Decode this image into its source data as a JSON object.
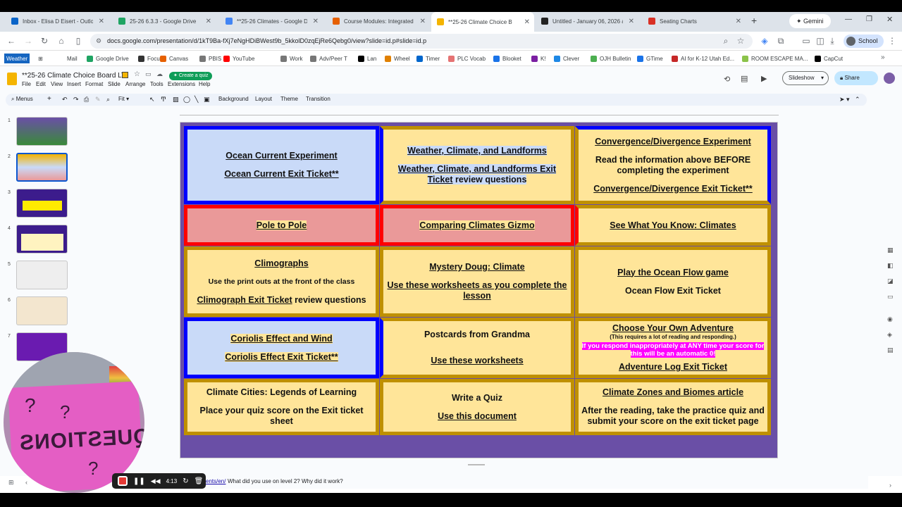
{
  "browser": {
    "tabs": [
      {
        "label": "Inbox - Elisa D Eisert - Outlo",
        "icon": "outlook-icon",
        "color": "#0a64c8"
      },
      {
        "label": "25-26 6.3.3 - Google Drive",
        "icon": "drive-icon",
        "color": "#1fa463"
      },
      {
        "label": "**25-26 Climates - Google D",
        "icon": "docs-icon",
        "color": "#4285f4"
      },
      {
        "label": "Course Modules: Integrated",
        "icon": "canvas-icon",
        "color": "#e66000"
      },
      {
        "label": "**25-26 Climate Choice B",
        "icon": "slides-icon",
        "color": "#f4b400"
      },
      {
        "label": "Untitled - January 06, 2026 a",
        "icon": "notion-icon",
        "color": "#222"
      },
      {
        "label": "Seating Charts",
        "icon": "seating-icon",
        "color": "#d93025"
      }
    ],
    "gemini_label": "Gemini",
    "url": "docs.google.com/presentation/d/1kT9Ba-fXj7eNgHDiBWest9b_5kkolD0zqEjRe6Qebg0/view?slide=id.p#slide=id.p",
    "profile_label": "School",
    "bookmarks": [
      "Weather",
      "Mail",
      "Google Drive",
      "Focus",
      "Canvas",
      "PBIS",
      "YouTube",
      "Work",
      "Adv/Peer T",
      "Lan",
      "Wheel",
      "Timer",
      "PLC Vocab",
      "Blooket",
      "K!",
      "Clever",
      "OJH Bulletin",
      "GTime",
      "AI for K-12 Utah Ed...",
      "ROOM ESCAPE MA...",
      "CapCut"
    ]
  },
  "docs": {
    "title": "**25-26 Climate Choice Board LTI",
    "quiz_button": "Create a quiz",
    "menu": [
      "File",
      "Edit",
      "View",
      "Insert",
      "Format",
      "Slide",
      "Arrange",
      "Tools",
      "Extensions",
      "Help"
    ],
    "toolbar": {
      "menus": "Menus",
      "zoom": "Fit",
      "background": "Background",
      "layout": "Layout",
      "theme": "Theme",
      "transition": "Transition"
    },
    "slideshow_label": "Slideshow",
    "share_label": "Share",
    "thumb_numbers": [
      "1",
      "2",
      "3",
      "4",
      "5",
      "6",
      "7"
    ]
  },
  "slide": {
    "cells": [
      {
        "lines": [
          {
            "t": "Ocean Current Experiment",
            "u": true,
            "hl": "blue"
          },
          {
            "gap": true
          },
          {
            "t": "Ocean Current Exit Ticket**",
            "u": true,
            "hl": "blue"
          }
        ]
      },
      {
        "lines": [
          {
            "t": "Weather, Climate, and Landforms",
            "u": true,
            "hl": "blue"
          },
          {
            "gap": true
          },
          {
            "t": "Weather, Climate, and Landforms Exit Ticket",
            "u": true,
            "hl": "blue",
            "tail": " review questions"
          }
        ]
      },
      {
        "lines": [
          {
            "t": "Convergence/Divergence Experiment",
            "u": true,
            "hl": "yel"
          },
          {
            "gap": true
          },
          {
            "t": "Read the information above BEFORE completing the experiment"
          },
          {
            "gap": true
          },
          {
            "t": "Convergence/Divergence Exit Ticket**",
            "u": true,
            "hl": "yel"
          }
        ]
      },
      {
        "lines": [
          {
            "t": "Pole to Pole",
            "u": true,
            "hl": "yel"
          }
        ]
      },
      {
        "lines": [
          {
            "t": "Comparing Climates Gizmo",
            "u": true,
            "hl": "yel"
          }
        ]
      },
      {
        "lines": [
          {
            "t": "See What You Know: Climates",
            "u": true,
            "hl": "yel"
          }
        ]
      },
      {
        "lines": [
          {
            "t": "Climographs",
            "u": true
          },
          {
            "gap": true
          },
          {
            "t": "Use the print outs at the front of the class",
            "s": true
          },
          {
            "gap": true
          },
          {
            "t": "Climograph Exit Ticket",
            "u": true,
            "tail": " review questions"
          }
        ]
      },
      {
        "lines": [
          {
            "t": "Mystery Doug: Climate",
            "u": true
          },
          {
            "gap": true
          },
          {
            "t": "Use these worksheets as you complete the lesson",
            "u": true
          }
        ]
      },
      {
        "lines": [
          {
            "t": "Play the Ocean Flow game",
            "u": true
          },
          {
            "gap": true
          },
          {
            "t": "Ocean Flow Exit Ticket"
          }
        ]
      },
      {
        "lines": [
          {
            "t": "Coriolis Effect and Wind",
            "u": true,
            "hl": "yel"
          },
          {
            "gap": true
          },
          {
            "t": "Coriolis Effect Exit Ticket**",
            "u": true,
            "hl": "yel"
          }
        ]
      },
      {
        "lines": [
          {
            "t": "Postcards from Grandma"
          },
          {
            "gap": true
          },
          {
            "gap": true
          },
          {
            "t": "Use these worksheets",
            "u": true
          }
        ]
      },
      {
        "lines": [
          {
            "t": "Choose Your Own Adventure",
            "u": true
          },
          {
            "t": "(This requires a lot of reading and responding.)",
            "xs": true
          },
          {
            "t": "If you respond inappropriately at ANY time your score for this will be an automatic 0!",
            "hl": "mag",
            "xs2": true
          },
          {
            "t": "Adventure Log Exit Ticket",
            "u": true
          }
        ]
      },
      {
        "lines": [
          {
            "t": "Climate Cities: Legends of Learning",
            "hl": "yel"
          },
          {
            "gap": true
          },
          {
            "t": "Place your quiz score on the Exit ticket sheet",
            "hl": "yel"
          }
        ]
      },
      {
        "lines": [
          {
            "t": "Write a Quiz"
          },
          {
            "gap": true
          },
          {
            "t": "Use this document",
            "u": true
          }
        ]
      },
      {
        "lines": [
          {
            "t": "Climate Zones and Biomes article",
            "u": true
          },
          {
            "gap": true
          },
          {
            "t": "After the reading, take the practice quiz and submit your score on the exit ticket page"
          }
        ]
      }
    ]
  },
  "recorder": {
    "time": "4:13"
  },
  "status_text": "What did you use on level 2? Why did it work?",
  "status_link": "ents/en/",
  "webcam_sign": "QUESTIONS"
}
